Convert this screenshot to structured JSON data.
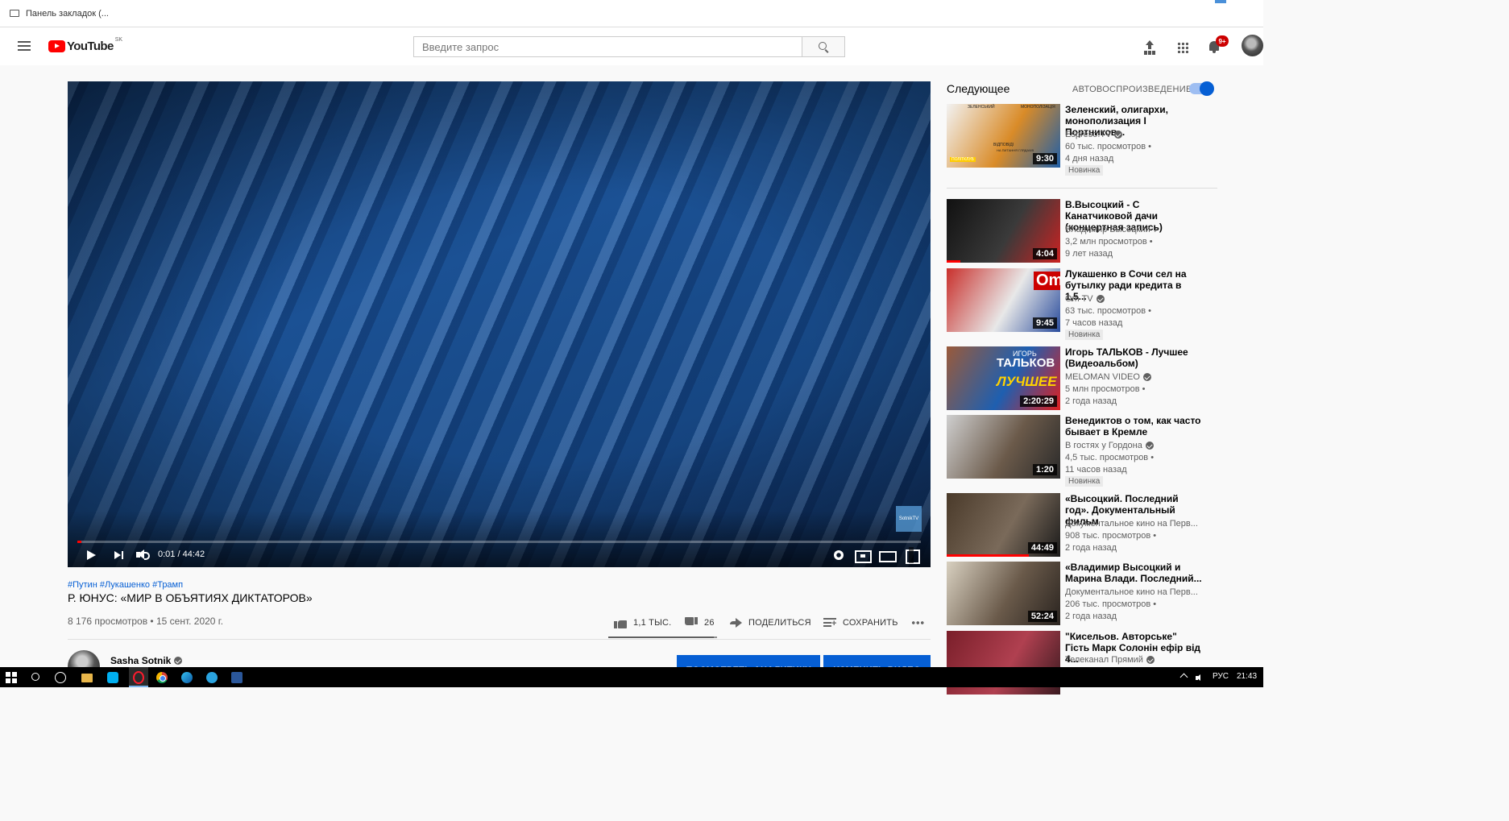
{
  "browser": {
    "bookmarks_bar_label": "Панель закладок (..."
  },
  "header": {
    "logo_text": "YouTube",
    "region": "SK",
    "search_placeholder": "Введите запрос",
    "notification_count": "9+"
  },
  "player": {
    "watermark": "SotnikTV",
    "time": "0:01 / 44:42",
    "progress_fraction": 0.0004
  },
  "video": {
    "hashtags": "#Путин #Лукашенко #Трамп",
    "title": "Р. ЮНУС: «МИР В ОБЪЯТИЯХ ДИКТАТОРОВ»",
    "meta": "8 176 просмотров • 15 сент. 2020 г.",
    "likes": "1,1 ТЫС.",
    "dislikes": "26",
    "like_fraction": 0.97,
    "share_label": "ПОДЕЛИТЬСЯ",
    "save_label": "СОХРАНИТЬ",
    "channel_name": "Sasha Sotnik",
    "analytics_button": "ПОСМОТРЕТЬ АНАЛИТИКУ",
    "edit_button": "ИЗМЕНИТЬ ВИДЕО"
  },
  "sidebar": {
    "next_label": "Следующее",
    "autoplay_label": "АВТОВОСПРОИЗВЕДЕНИЕ",
    "autoplay_on": true,
    "items": [
      {
        "title": "Зеленский, олигархи, монополизация І Портников...",
        "channel": "Espreso.TV",
        "views": "60 тыс. просмотров •",
        "age": "4 дня назад",
        "badge": "Новинка",
        "duration": "9:30",
        "thumb_texts": [
          "ЗЕЛЕНСЬКИЙ",
          "МОНОПОЛІЗАЦІЯ",
          "ВІДПОВІДІ",
          "НА ПИТАННЯ ГЛЯДАЧІВ",
          "ПОЛІТКЛУБ"
        ],
        "thumb_colors": [
          "#f2f2f2",
          "#d98b28",
          "#1f5fa8"
        ]
      },
      {
        "title": "В.Высоцкий - С Канатчиковой дачи (концертная запись)",
        "channel": "Владимир Высоцкий",
        "views": "3,2 млн просмотров •",
        "age": "9 лет назад",
        "badge": "",
        "duration": "4:04",
        "watched_fraction": 0.12,
        "thumb_colors": [
          "#111111",
          "#3a3a3a",
          "#cc2222"
        ]
      },
      {
        "title": "Лукашенко в Сочи сел на бутылку ради кредита в 1,5...",
        "channel": "Om TV",
        "views": "63 тыс. просмотров •",
        "age": "7 часов назад",
        "badge": "Новинка",
        "duration": "9:45",
        "thumb_texts": [
          "Om"
        ],
        "thumb_colors": [
          "#c9302c",
          "#e8e8e8",
          "#2a4c9c"
        ]
      },
      {
        "title": "Игорь ТАЛЬКОВ - Лучшее (Видеоальбом)",
        "channel": "MELOMAN VIDEO",
        "views": "5 млн просмотров •",
        "age": "2 года назад",
        "badge": "",
        "duration": "2:20:29",
        "thumb_texts": [
          "ИГОРЬ",
          "ТАЛЬКОВ",
          "ЛУЧШЕЕ"
        ],
        "thumb_colors": [
          "#9a5a3a",
          "#1e5fb0",
          "#e01f1f"
        ]
      },
      {
        "title": "Венедиктов о том, как часто бывает в Кремле",
        "channel": "В гостях у Гордона",
        "views": "4,5 тыс. просмотров •",
        "age": "11 часов назад",
        "badge": "Новинка",
        "duration": "1:20",
        "thumb_colors": [
          "#cfcfcf",
          "#6b5a4a",
          "#2a2a2a"
        ]
      },
      {
        "title": "«Высоцкий. Последний год». Документальный фильм",
        "channel": "Документальное кино на Перв...",
        "views": "908 тыс. просмотров •",
        "age": "2 года назад",
        "badge": "",
        "duration": "44:49",
        "watched_fraction": 0.72,
        "thumb_colors": [
          "#4a3a2a",
          "#7a6a5a",
          "#1a1a1a"
        ]
      },
      {
        "title": "«Владимир Высоцкий и Марина Влади. Последний...",
        "channel": "Документальное кино на Перв...",
        "views": "206 тыс. просмотров •",
        "age": "2 года назад",
        "badge": "",
        "duration": "52:24",
        "thumb_colors": [
          "#d8d0c0",
          "#6a5a4a",
          "#2a2420"
        ]
      },
      {
        "title": "\"Кисельов. Авторське\" Гість Марк Солонін ефір від 4...",
        "channel": "Телеканал Прямий",
        "views": "",
        "age": "",
        "badge": "",
        "duration": "",
        "thumb_colors": [
          "#7a1f2a",
          "#b04050",
          "#3a1a20"
        ]
      }
    ]
  },
  "taskbar": {
    "language": "РУС",
    "time": "21:43"
  }
}
